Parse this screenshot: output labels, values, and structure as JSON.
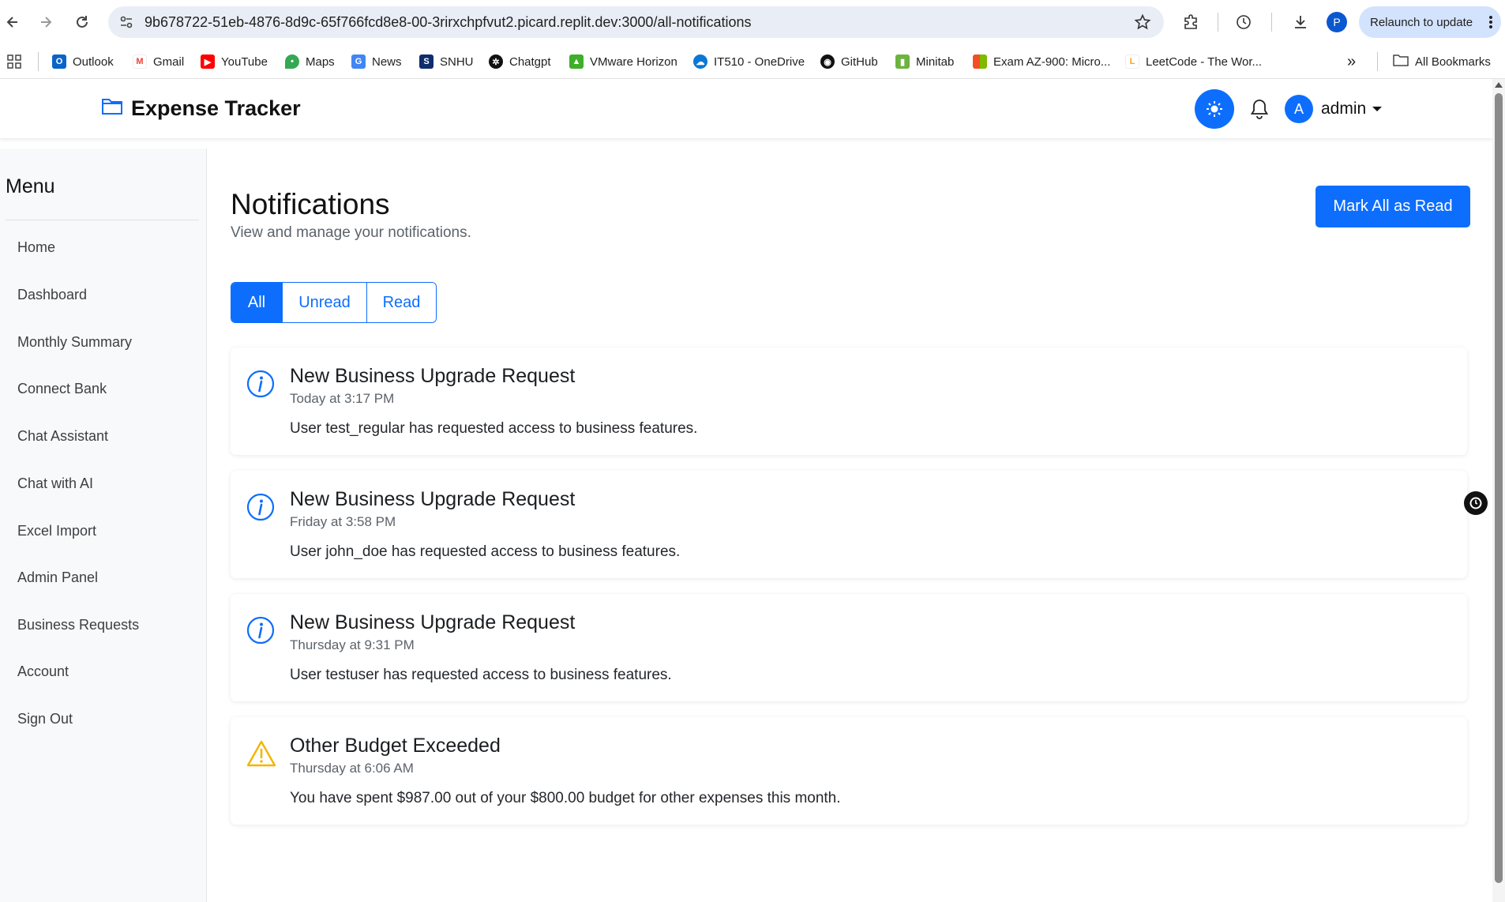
{
  "browser": {
    "url": "9b678722-51eb-4876-8d9c-65f766fcd8e8-00-3rirxchpfvut2.picard.replit.dev:3000/all-notifications",
    "profile_initial": "P",
    "relaunch_label": "Relaunch to update",
    "more_bookmarks": "»",
    "all_bookmarks_label": "All Bookmarks",
    "bookmarks": [
      {
        "label": "Outlook",
        "color": "#0a64c8"
      },
      {
        "label": "Gmail",
        "color": "#ea4335"
      },
      {
        "label": "YouTube",
        "color": "#ff0000"
      },
      {
        "label": "Maps",
        "color": "#34a853"
      },
      {
        "label": "News",
        "color": "#4285f4"
      },
      {
        "label": "SNHU",
        "color": "#0f2d6b"
      },
      {
        "label": "Chatgpt",
        "color": "#111111"
      },
      {
        "label": "VMware Horizon",
        "color": "#3fae29"
      },
      {
        "label": "IT510 - OneDrive",
        "color": "#0a78d4"
      },
      {
        "label": "GitHub",
        "color": "#111111"
      },
      {
        "label": "Minitab",
        "color": "#6cb33f"
      },
      {
        "label": "Exam AZ-900: Micro...",
        "color": "#f25022"
      },
      {
        "label": "LeetCode - The Wor...",
        "color": "#ffa116"
      }
    ]
  },
  "app": {
    "brand": "Expense Tracker",
    "user_initial": "A",
    "username": "admin",
    "accent_color": "#0d6efd"
  },
  "sidebar": {
    "title": "Menu",
    "items": [
      {
        "label": "Home"
      },
      {
        "label": "Dashboard"
      },
      {
        "label": "Monthly Summary"
      },
      {
        "label": "Connect Bank"
      },
      {
        "label": "Chat Assistant"
      },
      {
        "label": "Chat with AI"
      },
      {
        "label": "Excel Import"
      },
      {
        "label": "Admin Panel"
      },
      {
        "label": "Business Requests"
      },
      {
        "label": "Account"
      },
      {
        "label": "Sign Out"
      }
    ]
  },
  "main": {
    "title": "Notifications",
    "subtitle": "View and manage your notifications.",
    "mark_all_label": "Mark All as Read",
    "filters": [
      {
        "label": "All",
        "active": true
      },
      {
        "label": "Unread",
        "active": false
      },
      {
        "label": "Read",
        "active": false
      }
    ],
    "notifications": [
      {
        "icon": "info-icon",
        "title": "New Business Upgrade Request",
        "time": "Today at 3:17 PM",
        "message": "User test_regular has requested access to business features."
      },
      {
        "icon": "info-icon",
        "title": "New Business Upgrade Request",
        "time": "Friday at 3:58 PM",
        "message": "User john_doe has requested access to business features."
      },
      {
        "icon": "info-icon",
        "title": "New Business Upgrade Request",
        "time": "Thursday at 9:31 PM",
        "message": "User testuser has requested access to business features."
      },
      {
        "icon": "warning-icon",
        "title": "Other Budget Exceeded",
        "time": "Thursday at 6:06 AM",
        "message": "You have spent $987.00 out of your $800.00 budget for other expenses this month."
      }
    ]
  }
}
